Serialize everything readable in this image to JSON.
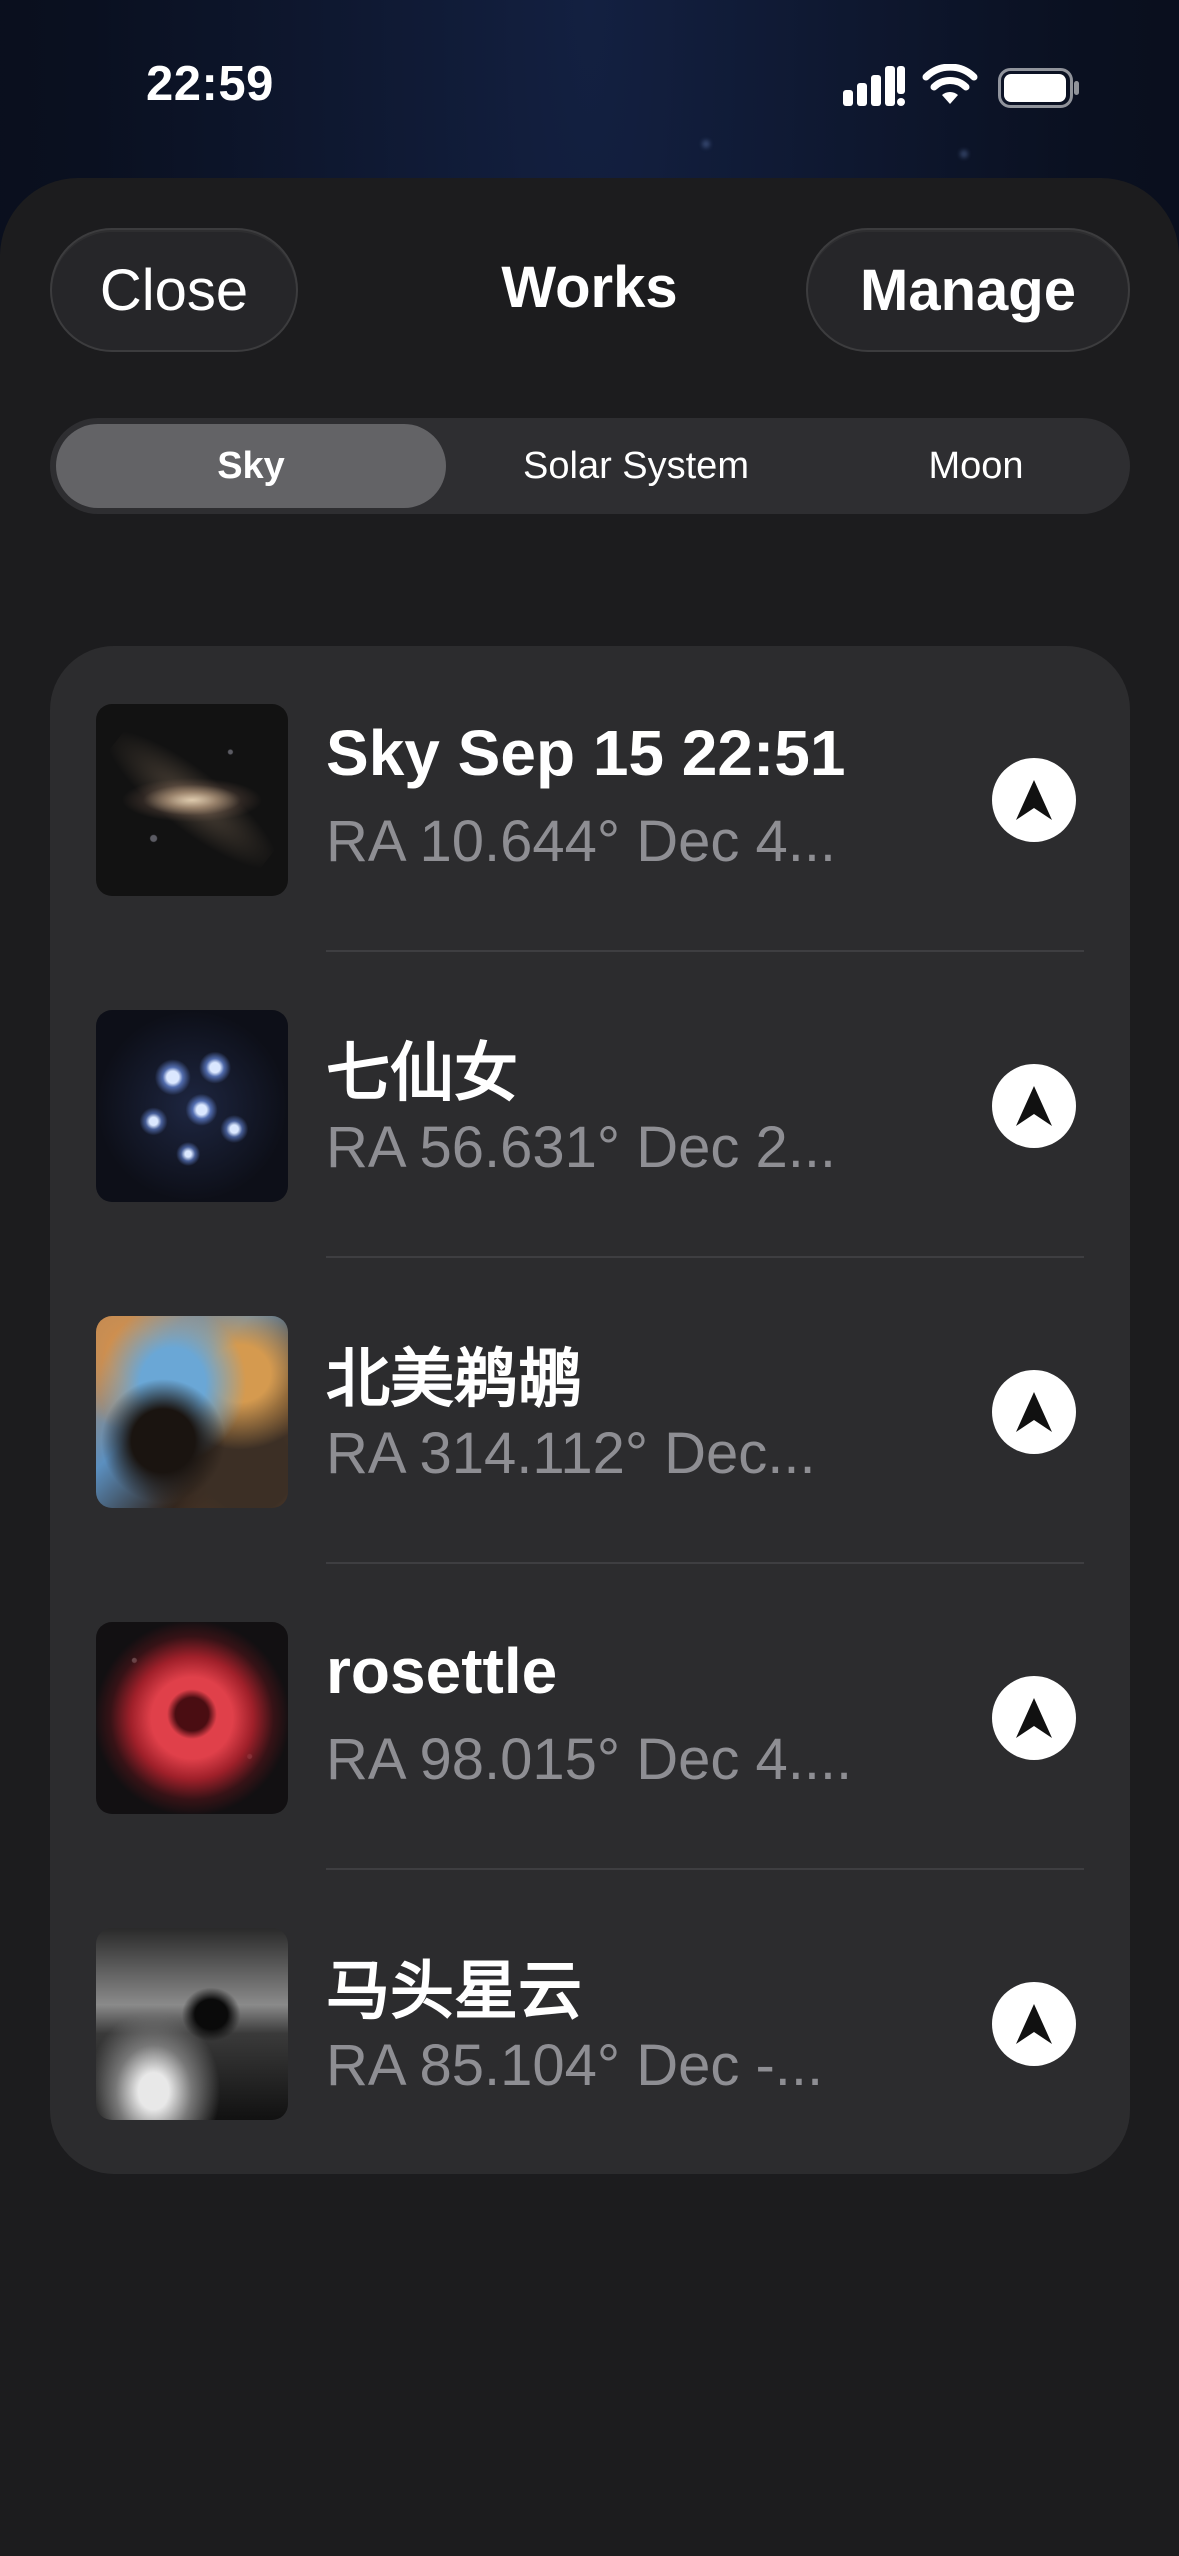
{
  "status_bar": {
    "time": "22:59",
    "icons": [
      "cellular-signal-icon",
      "wifi-icon",
      "battery-icon"
    ]
  },
  "header": {
    "close_label": "Close",
    "title": "Works",
    "manage_label": "Manage"
  },
  "segments": [
    {
      "label": "Sky",
      "selected": true
    },
    {
      "label": "Solar System",
      "selected": false
    },
    {
      "label": "Moon",
      "selected": false
    }
  ],
  "works": [
    {
      "title": "Sky Sep 15 22:51",
      "subtitle": "RA 10.644°  Dec 4...",
      "thumbnail": "andromeda-galaxy",
      "action_icon": "navigate-arrow-icon"
    },
    {
      "title": "七仙女",
      "subtitle": "RA 56.631°  Dec 2...",
      "thumbnail": "pleiades-cluster",
      "action_icon": "navigate-arrow-icon"
    },
    {
      "title": "北美鹈鹕",
      "subtitle": "RA 314.112°  Dec...",
      "thumbnail": "north-america-pelican-nebula",
      "action_icon": "navigate-arrow-icon"
    },
    {
      "title": "rosettle",
      "subtitle": "RA 98.015°  Dec 4....",
      "thumbnail": "rosette-nebula",
      "action_icon": "navigate-arrow-icon"
    },
    {
      "title": "马头星云",
      "subtitle": "RA 85.104°  Dec -...",
      "thumbnail": "horsehead-nebula",
      "action_icon": "navigate-arrow-icon"
    }
  ],
  "colors": {
    "sheet_background": "#1c1c1e",
    "card_background": "#2c2c2e",
    "selected_segment": "#636366",
    "secondary_text": "#8e8e93"
  }
}
